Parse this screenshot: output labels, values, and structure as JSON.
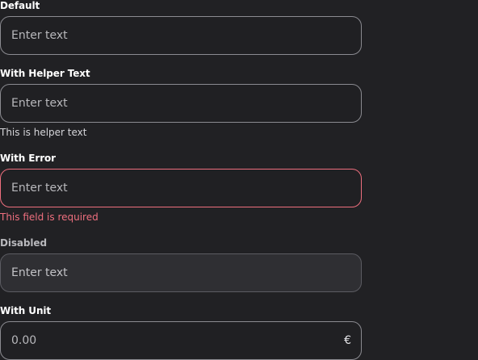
{
  "fields": {
    "default": {
      "label": "Default",
      "placeholder": "Enter text"
    },
    "helper": {
      "label": "With Helper Text",
      "placeholder": "Enter text",
      "helper_text": "This is helper text"
    },
    "error": {
      "label": "With Error",
      "placeholder": "Enter text",
      "error_text": "This field is required"
    },
    "disabled": {
      "label": "Disabled",
      "placeholder": "Enter text"
    },
    "unit": {
      "label": "With Unit",
      "placeholder": "0.00",
      "unit": "€"
    }
  },
  "colors": {
    "background": "#212124",
    "border": "#8b8b91",
    "error": "#ee6f7e",
    "disabled_bg": "#2f2f33"
  }
}
